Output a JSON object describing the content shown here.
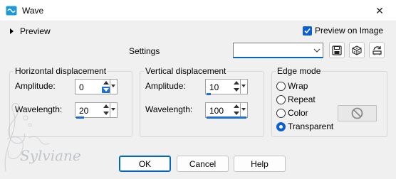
{
  "window": {
    "title": "Wave",
    "close_glyph": "✕",
    "app_icon": "wave-app-icon"
  },
  "preview": {
    "label": "Preview",
    "preview_on_image_label": "Preview on Image",
    "preview_on_image_checked": true
  },
  "settings": {
    "label": "Settings",
    "preset_value": ""
  },
  "horizontal": {
    "title": "Horizontal displacement",
    "amplitude_label": "Amplitude:",
    "amplitude_value": "0",
    "amplitude_level": 0.0,
    "wavelength_label": "Wavelength:",
    "wavelength_value": "20",
    "wavelength_level": 0.2
  },
  "vertical": {
    "title": "Vertical displacement",
    "amplitude_label": "Amplitude:",
    "amplitude_value": "10",
    "amplitude_level": 0.1,
    "wavelength_label": "Wavelength:",
    "wavelength_value": "100",
    "wavelength_level": 1.0
  },
  "edge_mode": {
    "title": "Edge mode",
    "options": [
      {
        "label": "Wrap",
        "selected": false
      },
      {
        "label": "Repeat",
        "selected": false
      },
      {
        "label": "Color",
        "selected": false
      },
      {
        "label": "Transparent",
        "selected": true
      }
    ]
  },
  "buttons": {
    "ok": "OK",
    "cancel": "Cancel",
    "help": "Help"
  },
  "watermark": {
    "text": "Sylviane"
  },
  "colors": {
    "accent": "#0067c0"
  }
}
